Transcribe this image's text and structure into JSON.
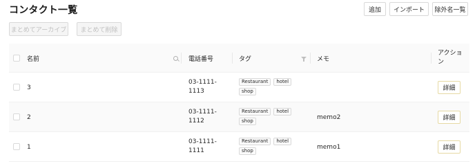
{
  "header": {
    "title": "コンタクト一覧",
    "add_label": "追加",
    "import_label": "インポート",
    "excluded_list_label": "除外名一覧"
  },
  "bulk_actions": {
    "archive_label": "まとめてアーカイブ",
    "delete_label": "まとめて削除"
  },
  "table": {
    "columns": {
      "name": "名前",
      "phone": "電話番号",
      "tag": "タグ",
      "memo": "メモ",
      "action_line1": "アクショ",
      "action_line2": "ン"
    },
    "rows": [
      {
        "name": "3",
        "phone_line1": "03-1111-",
        "phone_line2": "1113",
        "tags": [
          "Restaurant",
          "hotel",
          "shop"
        ],
        "memo": "",
        "action_label": "詳細"
      },
      {
        "name": "2",
        "phone_line1": "03-1111-",
        "phone_line2": "1112",
        "tags": [
          "Restaurant",
          "hotel",
          "shop"
        ],
        "memo": "memo2",
        "action_label": "詳細"
      },
      {
        "name": "1",
        "phone_line1": "03-1111-",
        "phone_line2": "1111",
        "tags": [
          "Restaurant",
          "hotel",
          "shop"
        ],
        "memo": "memo1",
        "action_label": "詳細"
      }
    ]
  },
  "icons": {
    "name_column_icon": "search-icon",
    "tag_column_icon": "filter-icon"
  },
  "colors": {
    "detail_button_border": "#e6d9a3",
    "disabled_text": "#bfbfbf",
    "header_background": "#fafafa"
  }
}
